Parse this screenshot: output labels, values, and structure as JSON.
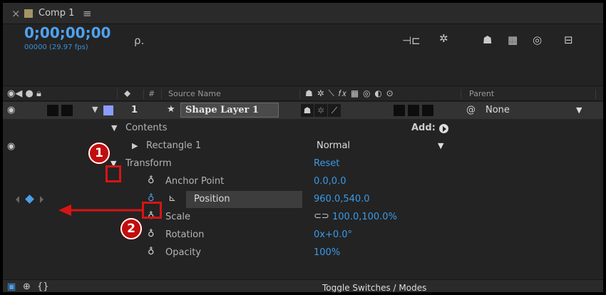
{
  "tab": {
    "close": "×",
    "title": "Comp 1",
    "menu": "≡",
    "swatch_color": "#a39466"
  },
  "timecode": {
    "value": "0;00;00;00",
    "frames": "00000 (29.97 fps)",
    "search_icon": "ρ."
  },
  "columns": {
    "source_name": "Source Name",
    "number": "#",
    "parent": "Parent"
  },
  "layer": {
    "number": "1",
    "star": "★",
    "name": "Shape Layer 1",
    "parent_icon": "@",
    "parent_value": "None",
    "color": "#8a9cff"
  },
  "rows": {
    "contents": "Contents",
    "add_label": "Add:",
    "rectangle": "Rectangle 1",
    "blend_mode": "Normal",
    "transform": "Transform",
    "reset": "Reset"
  },
  "properties": [
    {
      "name": "Anchor Point",
      "value": "0.0,0.0"
    },
    {
      "name": "Position",
      "value": "960.0,540.0"
    },
    {
      "name": "Scale",
      "value": "100.0,100.0%"
    },
    {
      "name": "Rotation",
      "value": "0x+0.0°"
    },
    {
      "name": "Opacity",
      "value": "100%"
    }
  ],
  "footer": {
    "toggle_label": "Toggle Switches / Modes"
  },
  "callouts": [
    "1",
    "2"
  ],
  "colors": {
    "accent": "#3a9ae8",
    "annotation": "#d81414",
    "panel": "#232323"
  }
}
